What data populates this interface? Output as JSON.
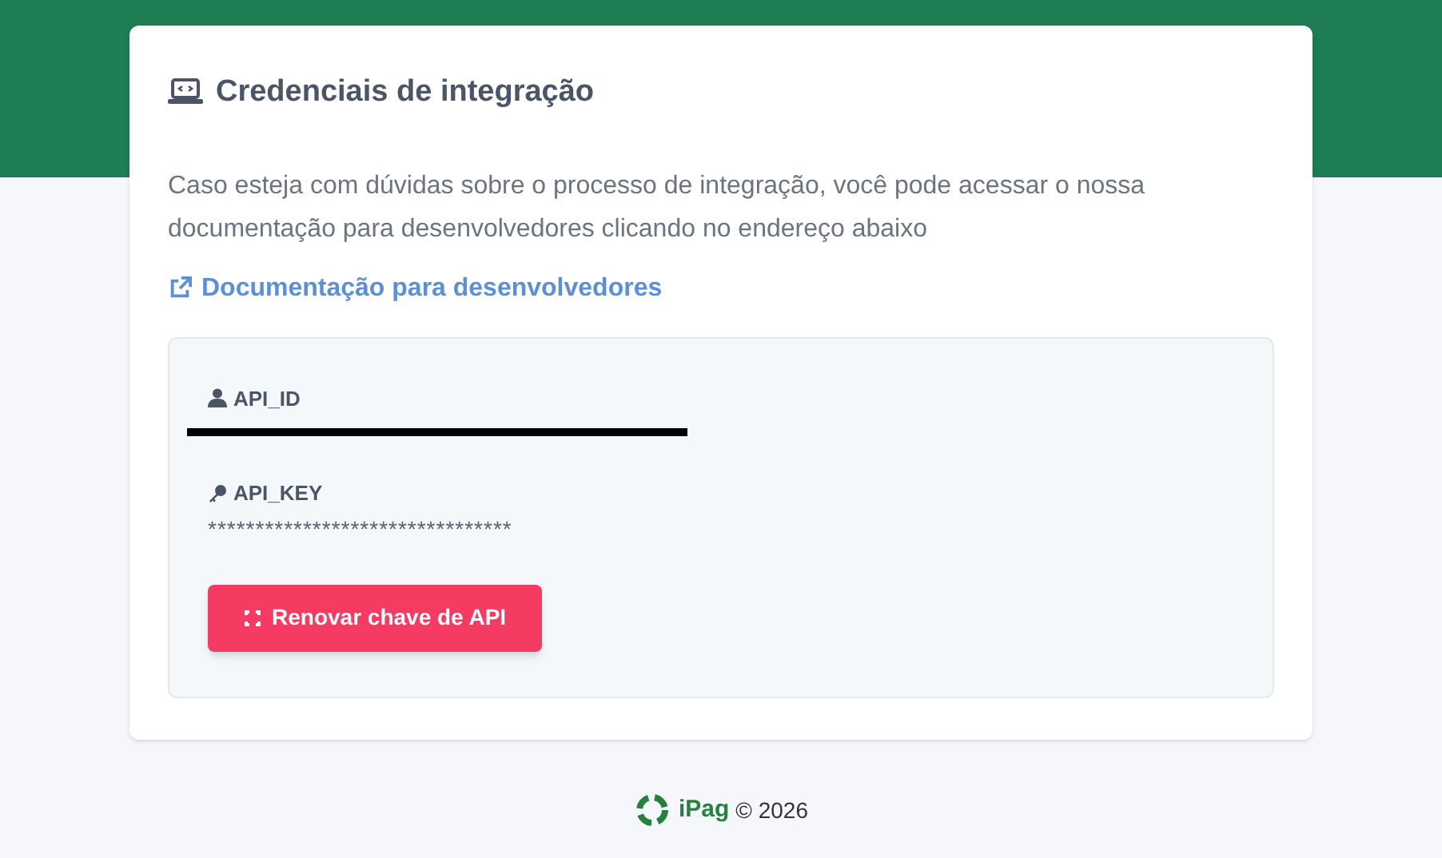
{
  "card": {
    "title": "Credenciais de integração",
    "description": "Caso esteja com dúvidas sobre o processo de integração, você pode acessar o nossa documentação para desenvolvedores clicando no endereço abaixo",
    "link": "Documentação para desenvolvedores"
  },
  "credentials": [
    {
      "kind": "user",
      "label": "API_ID",
      "redacted": true
    },
    {
      "kind": "key",
      "label": "API_KEY",
      "value": "********************************",
      "redacted": false
    }
  ],
  "renew_button": "Renovar chave de API",
  "footer": {
    "brand": "iPag",
    "copyright": "© 2026"
  }
}
